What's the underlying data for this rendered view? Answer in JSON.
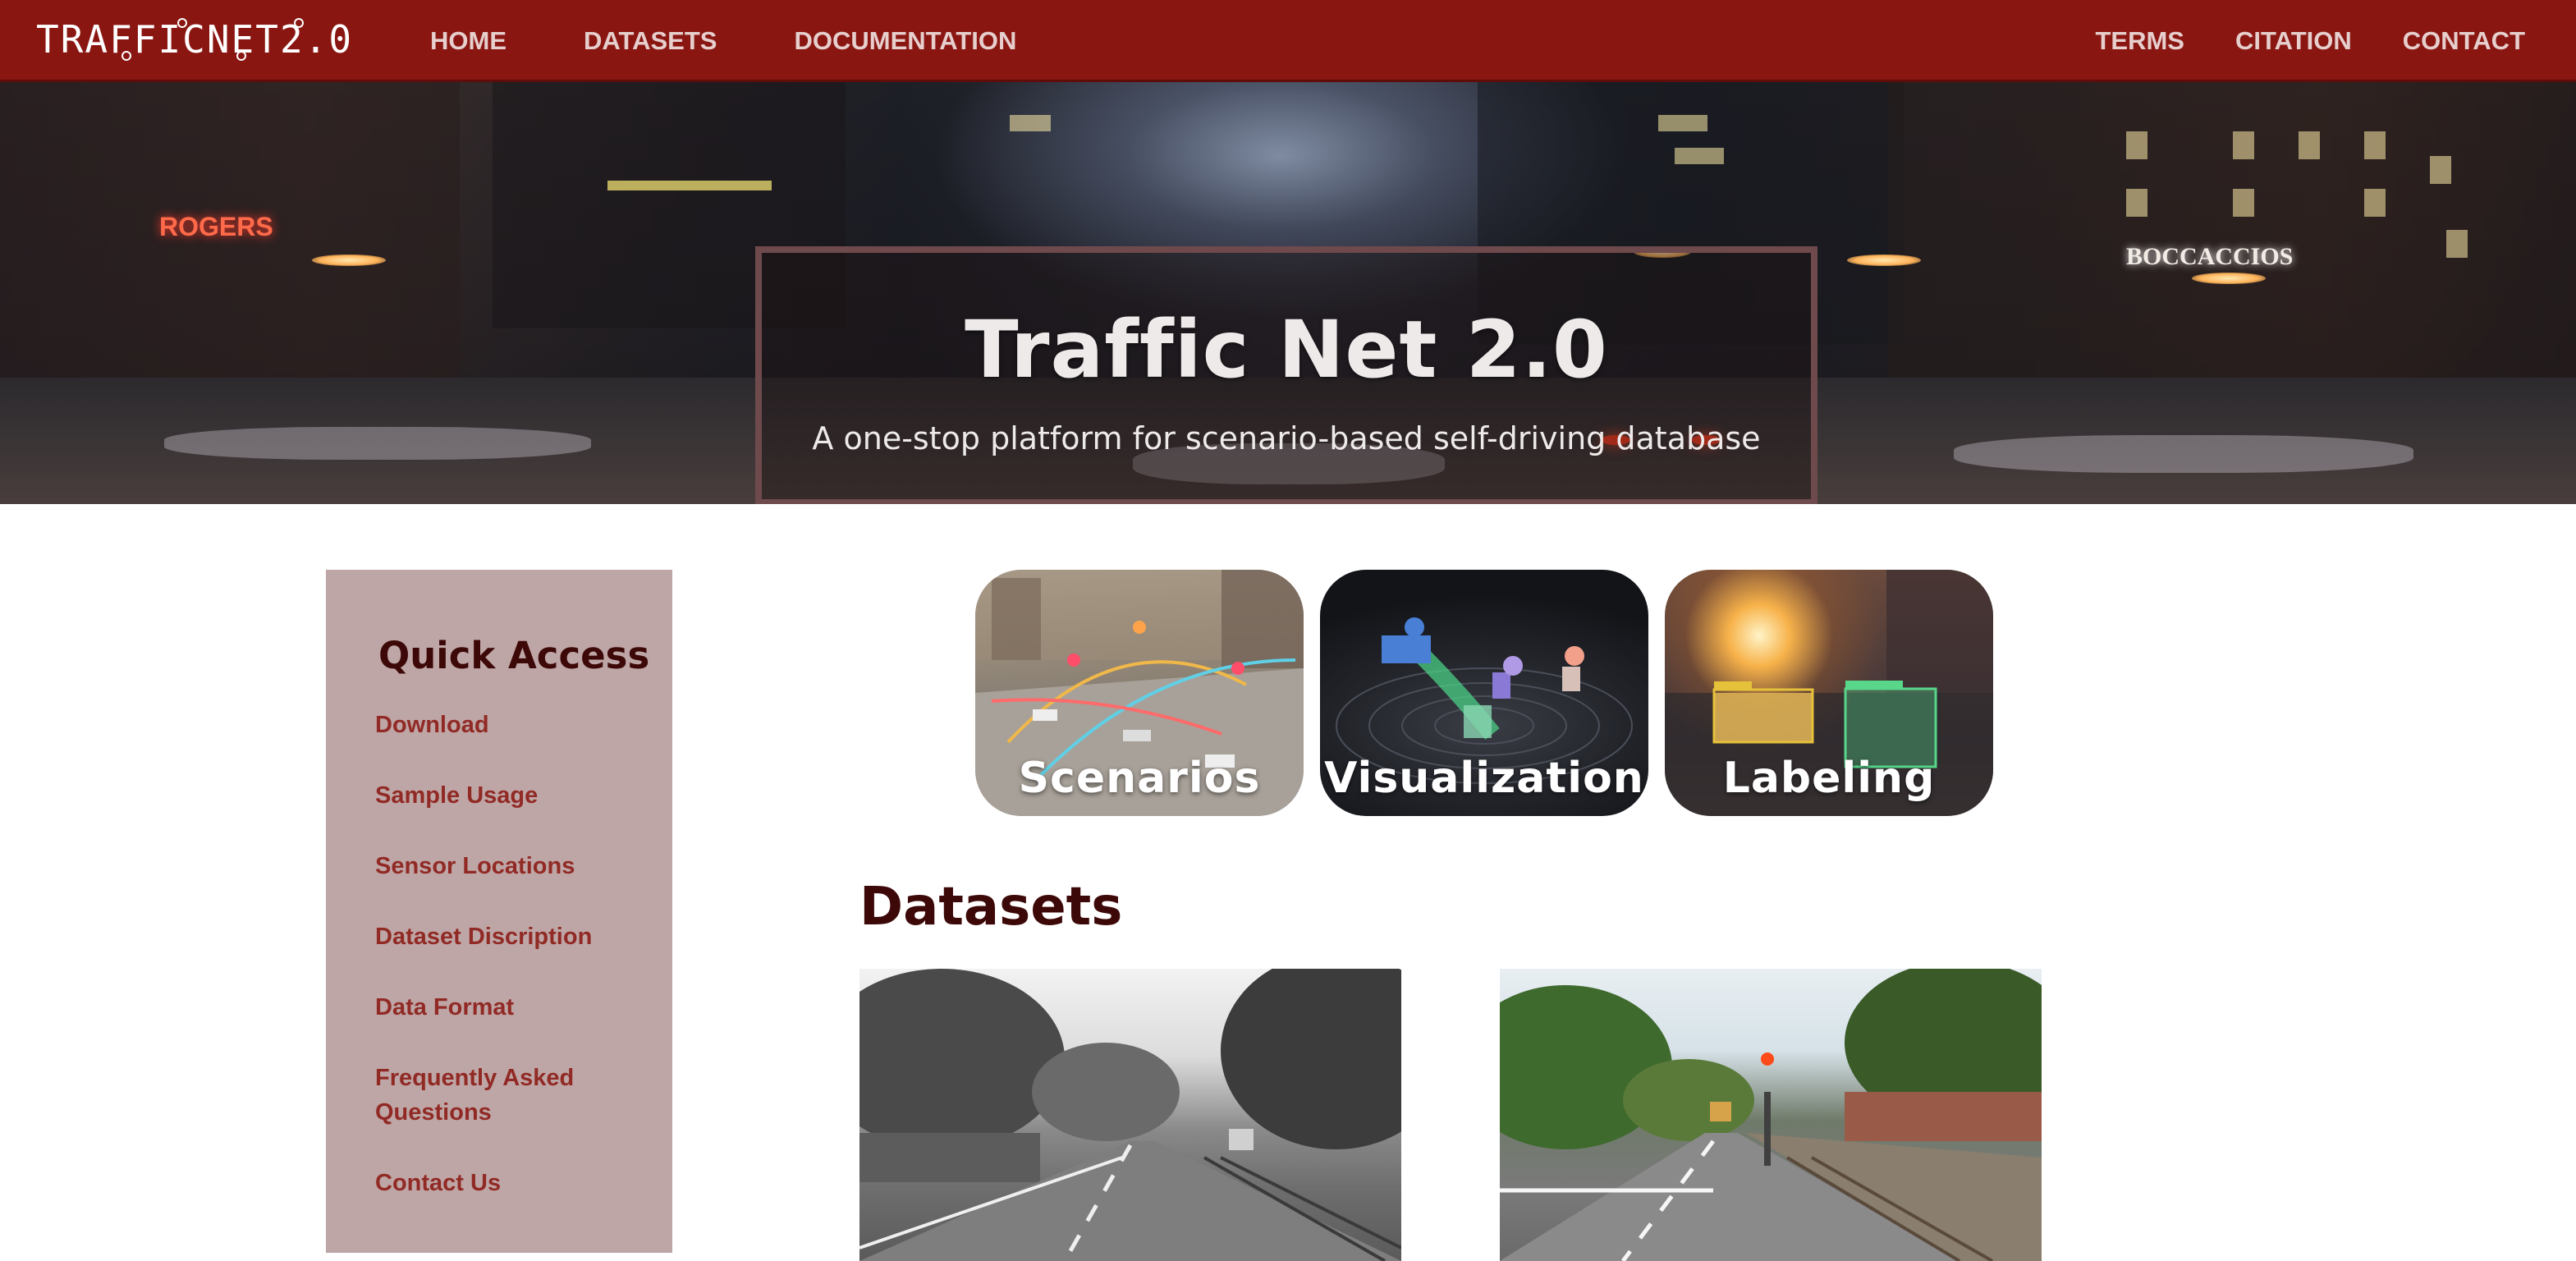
{
  "nav": {
    "logo_text": "TRAFFICNET2.0",
    "left_links": [
      "HOME",
      "DATASETS",
      "DOCUMENTATION"
    ],
    "right_links": [
      "TERMS",
      "CITATION",
      "CONTACT"
    ],
    "bar_color": "#8a1612"
  },
  "hero": {
    "title": "Traffic Net 2.0",
    "subtitle": "A one-stop platform for scenario-based self-driving database",
    "sign_left": "ROGERS",
    "sign_right": "BOCCACCIOS"
  },
  "sidebar": {
    "title": "Quick Access",
    "items": [
      "Download",
      "Sample Usage",
      "Sensor Locations",
      "Dataset Discription",
      "Data Format",
      "Frequently Asked Questions",
      "Contact Us"
    ],
    "background_color": "#bfa6a6",
    "link_color": "#912a25"
  },
  "features": [
    {
      "label": "Scenarios",
      "icon": "scenarios-image"
    },
    {
      "label": "Visualization",
      "icon": "visualization-image"
    },
    {
      "label": "Labeling",
      "icon": "labeling-image"
    }
  ],
  "datasets": {
    "heading": "Datasets",
    "cards": [
      {
        "icon": "dataset-street-grayscale-image"
      },
      {
        "icon": "dataset-street-color-image"
      }
    ]
  }
}
